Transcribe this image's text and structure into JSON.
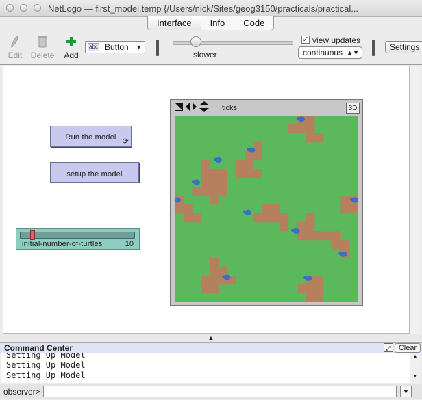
{
  "window": {
    "title": "NetLogo — first_model.temp {/Users/nick/Sites/geog3150/practicals/practical..."
  },
  "tabs": [
    {
      "label": "Interface",
      "active": true
    },
    {
      "label": "Info",
      "active": false
    },
    {
      "label": "Code",
      "active": false
    }
  ],
  "toolbar": {
    "edit_label": "Edit",
    "delete_label": "Delete",
    "add_label": "Add",
    "widget_type": {
      "tag": "abc",
      "value": "Button"
    },
    "speed_label": "slower",
    "view_updates_label": "view updates",
    "view_updates_checked": true,
    "view_updates_check_glyph": "✓",
    "update_mode": "continuous",
    "settings_label": "Settings"
  },
  "widgets": {
    "run_button": {
      "label": "Run the model",
      "forever": true
    },
    "setup_button": {
      "label": "setup the model"
    },
    "slider": {
      "name": "initial-number-of-turtles",
      "value": 10,
      "level": 0.1
    }
  },
  "view": {
    "ticks_label": "ticks:",
    "three_d_label": "3D",
    "colors": {
      "grass": "#5cb85c",
      "patch": "#b5805d",
      "turtle": "#3a6ec9",
      "frame": "#c8c8c8"
    },
    "grid": {
      "cols": 21,
      "rows": 21
    },
    "brown_patches": [
      [
        14,
        0
      ],
      [
        15,
        0
      ],
      [
        13,
        1
      ],
      [
        14,
        1
      ],
      [
        15,
        1
      ],
      [
        15,
        2
      ],
      [
        16,
        2
      ],
      [
        9,
        3
      ],
      [
        8,
        4
      ],
      [
        9,
        4
      ],
      [
        7,
        5
      ],
      [
        8,
        5
      ],
      [
        7,
        6
      ],
      [
        3,
        5
      ],
      [
        4,
        6
      ],
      [
        3,
        6
      ],
      [
        7,
        6
      ],
      [
        8,
        6
      ],
      [
        9,
        6
      ],
      [
        3,
        6
      ],
      [
        3,
        6
      ],
      [
        4,
        6
      ],
      [
        5,
        6
      ],
      [
        3,
        7
      ],
      [
        4,
        7
      ],
      [
        5,
        7
      ],
      [
        2,
        8
      ],
      [
        3,
        8
      ],
      [
        4,
        8
      ],
      [
        5,
        8
      ],
      [
        4,
        9
      ],
      [
        0,
        9
      ],
      [
        0,
        10
      ],
      [
        1,
        10
      ],
      [
        1,
        11
      ],
      [
        2,
        11
      ],
      [
        0,
        9
      ],
      [
        20,
        9
      ],
      [
        19,
        9
      ],
      [
        19,
        10
      ],
      [
        20,
        10
      ],
      [
        10,
        10
      ],
      [
        11,
        10
      ],
      [
        9,
        11
      ],
      [
        10,
        11
      ],
      [
        11,
        11
      ],
      [
        12,
        11
      ],
      [
        12,
        12
      ],
      [
        15,
        11
      ],
      [
        14,
        12
      ],
      [
        15,
        12
      ],
      [
        14,
        13
      ],
      [
        15,
        13
      ],
      [
        16,
        13
      ],
      [
        17,
        13
      ],
      [
        18,
        13
      ],
      [
        18,
        14
      ],
      [
        19,
        14
      ],
      [
        19,
        15
      ],
      [
        4,
        16
      ],
      [
        4,
        17
      ],
      [
        5,
        17
      ],
      [
        3,
        18
      ],
      [
        4,
        18
      ],
      [
        5,
        18
      ],
      [
        6,
        18
      ],
      [
        4,
        19
      ],
      [
        3,
        19
      ],
      [
        15,
        18
      ],
      [
        16,
        18
      ],
      [
        14,
        19
      ],
      [
        15,
        19
      ],
      [
        16,
        19
      ],
      [
        16,
        20
      ],
      [
        15,
        20
      ],
      [
        7,
        5
      ],
      [
        7,
        6
      ]
    ],
    "turtles": [
      [
        14.5,
        0.4
      ],
      [
        8.8,
        3.9
      ],
      [
        5.0,
        5.0
      ],
      [
        2.5,
        7.5
      ],
      [
        0.3,
        9.5
      ],
      [
        20.6,
        9.5
      ],
      [
        8.4,
        10.9
      ],
      [
        13.9,
        13.0
      ],
      [
        19.3,
        15.6
      ],
      [
        6.0,
        18.2
      ],
      [
        15.3,
        18.3
      ]
    ]
  },
  "command_center": {
    "title": "Command Center",
    "clear_label": "Clear",
    "output_lines": [
      "Setting Up Model",
      "Setting Up Model",
      "Setting Up Model"
    ],
    "observer_label": "observer>",
    "input_value": ""
  }
}
